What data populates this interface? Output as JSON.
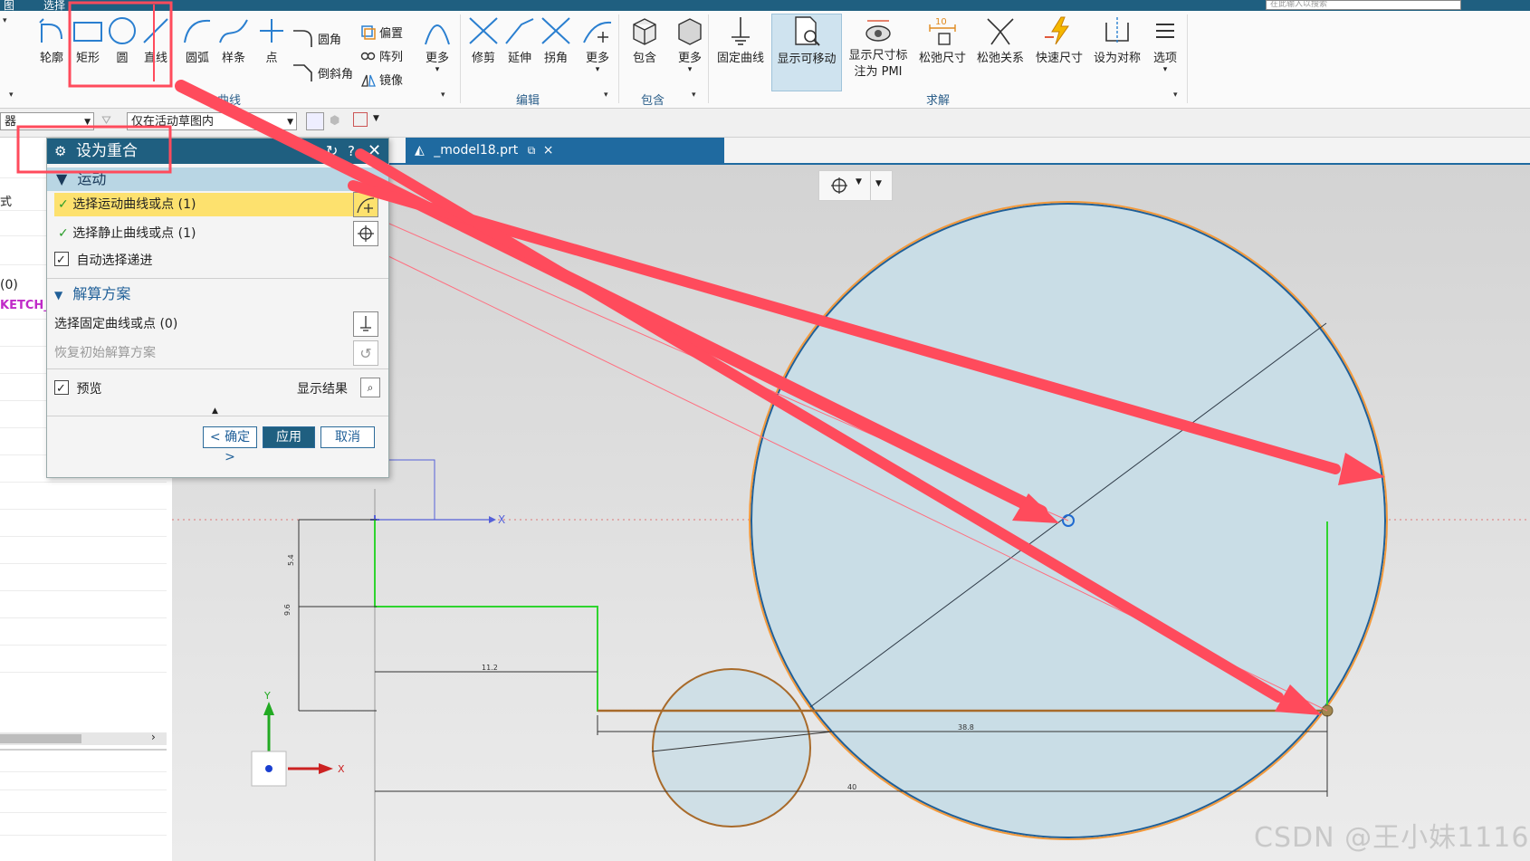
{
  "topbar": {
    "menu_left": "图",
    "menu_mid": "选择",
    "search_placeholder": "在此输入以搜索"
  },
  "ribbon": {
    "curve_tools": [
      "轮廓",
      "矩形",
      "圆",
      "直线",
      "圆弧",
      "样条",
      "点"
    ],
    "curve_small": [
      "圆角",
      "倒斜角",
      "偏置",
      "阵列",
      "镜像"
    ],
    "curve_more": "更多",
    "edit_tools": [
      "修剪",
      "延伸",
      "拐角"
    ],
    "edit_more": "更多",
    "include_tools": [
      "包含"
    ],
    "include_more": "更多",
    "solve_tools": [
      "固定曲线",
      "显示可移动",
      "显示尺寸标注为 PMI",
      "松弛尺寸",
      "松弛关系",
      "快速尺寸",
      "设为对称",
      "选项"
    ],
    "dim_value": "10",
    "groups": {
      "curve": "曲线",
      "edit": "编辑",
      "include": "包含",
      "solve": "求解"
    }
  },
  "toolbar2": {
    "filter_left": "器",
    "filter_scope": "仅在活动草图内"
  },
  "leftnav": {
    "frag1": "式",
    "frag2": "(0)",
    "frag3": "KETCH_"
  },
  "tab": {
    "label": "_model18.prt"
  },
  "dialog": {
    "title": "设为重合",
    "section_motion": "运动",
    "select_motion": "选择运动曲线或点 (1)",
    "select_static": "选择静止曲线或点 (1)",
    "auto_select": "自动选择递进",
    "section_solve": "解算方案",
    "select_fixed": "选择固定曲线或点 (0)",
    "restore": "恢复初始解算方案",
    "preview": "预览",
    "show_result": "显示结果",
    "ok": "< 确定 >",
    "apply": "应用",
    "cancel": "取消"
  },
  "canvas": {
    "dims": [
      "5.4",
      "9.6",
      "11.2",
      "38.8",
      "40"
    ],
    "axis_x": "X",
    "axis_y": "Y"
  },
  "colors": {
    "title_bar": "#1f5f80",
    "annotation_red": "#ff4b5c",
    "highlight_yellow": "#fde16e",
    "constraint_green": "#22cc22",
    "circle_orange": "#f39a3c"
  },
  "watermark": "CSDN @王小妹1116"
}
